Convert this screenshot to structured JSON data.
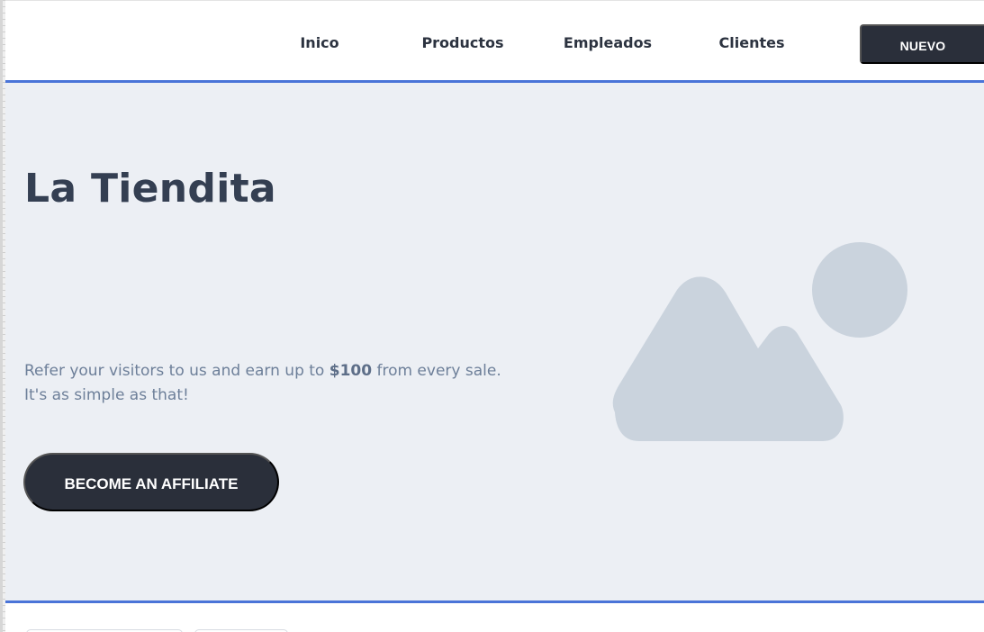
{
  "nav": {
    "links": [
      {
        "label": "Inico"
      },
      {
        "label": "Productos"
      },
      {
        "label": "Empleados"
      },
      {
        "label": "Clientes"
      }
    ],
    "new_button": "NUEVO"
  },
  "hero": {
    "title": "La Tiendita",
    "text_before": "Refer your visitors to us and earn up to ",
    "text_bold": "$100",
    "text_after": " from every sale.",
    "text_line2": "It's as simple as that!",
    "cta_label": "BECOME AN AFFILIATE",
    "image_icon": "image-placeholder-icon"
  },
  "colors": {
    "accent_line": "#4a74d8",
    "dark_button": "#2a2f3a",
    "hero_bg": "#eceff4",
    "title": "#343f52",
    "body_text": "#6d7f99",
    "placeholder": "#cad3dd"
  }
}
